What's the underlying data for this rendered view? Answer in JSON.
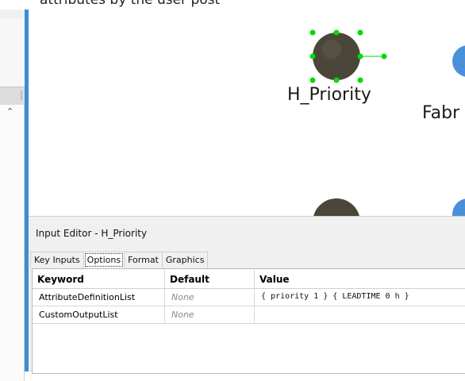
{
  "canvas": {
    "top_text": "attributes by the user post",
    "nodes": [
      {
        "label": "H_Priority"
      },
      {
        "label": "Fabr"
      }
    ]
  },
  "editor": {
    "title": "Input Editor - H_Priority",
    "tabs": [
      {
        "label": "Key Inputs"
      },
      {
        "label": "Options",
        "active": true
      },
      {
        "label": "Format"
      },
      {
        "label": "Graphics"
      }
    ],
    "table": {
      "headers": {
        "keyword": "Keyword",
        "default": "Default",
        "value": "Value"
      },
      "rows": [
        {
          "keyword": "AttributeDefinitionList",
          "default": "None",
          "value": "{ priority  1 } { LEADTIME  0  h }"
        },
        {
          "keyword": "CustomOutputList",
          "default": "None",
          "value": ""
        }
      ]
    }
  },
  "colors": {
    "accent_blue": "#3a8ed4",
    "selection_green": "#00dd00",
    "entity_fill": "#4a463a",
    "shape_blue": "#4a90d9"
  }
}
